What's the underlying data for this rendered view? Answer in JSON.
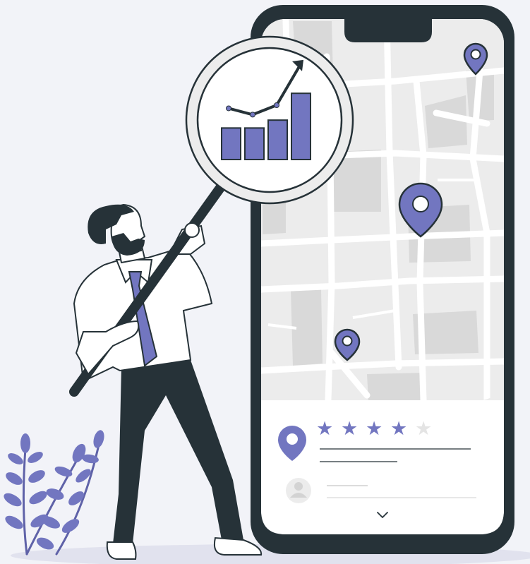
{
  "colors": {
    "background": "#f2f3f8",
    "accent": "#7276c0",
    "ink": "#263238",
    "map_base": "#ececec",
    "map_block": "#d9d9d9",
    "road": "#ffffff",
    "star_inactive": "#e4e4e4",
    "shadow": "#e1e2ee"
  },
  "icons": [
    "map-pin-icon",
    "star-icon",
    "user-avatar-icon",
    "chevron-down-icon",
    "magnifying-glass-icon",
    "growth-chart-icon",
    "leaf-plant-icon"
  ],
  "review_card": {
    "rating": 4,
    "rating_max": 5,
    "chevron_glyph": "⌄"
  },
  "chart_data": {
    "type": "bar",
    "categories": [
      "",
      "",
      "",
      ""
    ],
    "values": [
      2,
      2,
      2.5,
      4.2
    ],
    "trend_line": [
      2.8,
      2.4,
      3.0,
      5.6
    ],
    "ylim": [
      0,
      6
    ],
    "title": "",
    "xlabel": "",
    "ylabel": ""
  }
}
